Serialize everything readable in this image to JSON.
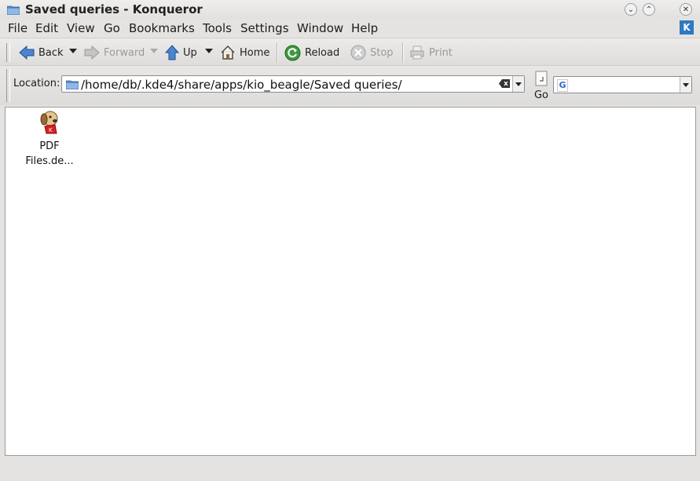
{
  "window": {
    "title": "Saved queries - Konqueror"
  },
  "menu": {
    "items": [
      "File",
      "Edit",
      "View",
      "Go",
      "Bookmarks",
      "Tools",
      "Settings",
      "Window",
      "Help"
    ]
  },
  "toolbar": {
    "back": "Back",
    "forward": "Forward",
    "up": "Up",
    "home": "Home",
    "reload": "Reload",
    "stop": "Stop",
    "print": "Print"
  },
  "location": {
    "label": "Location:",
    "path": "/home/db/.kde4/share/apps/kio_beagle/Saved queries/",
    "go": "Go"
  },
  "search": {
    "value": ""
  },
  "files": [
    {
      "name_line1": "PDF",
      "name_line2": "Files.de..."
    }
  ],
  "colors": {
    "accent": "#2f78c2"
  }
}
